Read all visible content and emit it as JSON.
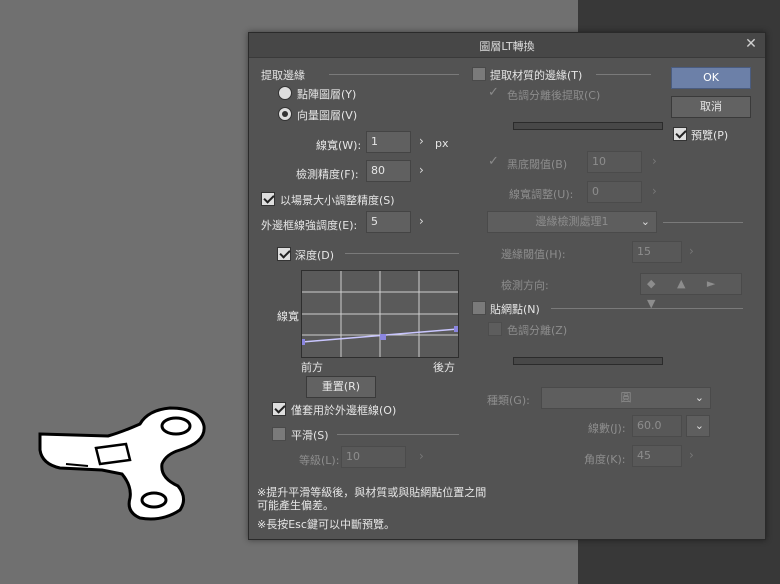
{
  "dialog": {
    "title": "圖層LT轉換",
    "close_icon": "close-icon",
    "extract_lines": {
      "header": "提取邊緣",
      "raster_layer": "點陣圖層(Y)",
      "vector_layer": "向量圖層(V)",
      "line_width_label": "線寬(W):",
      "line_width_value": "1",
      "line_width_unit": "px",
      "precision_label": "檢測精度(F):",
      "precision_value": "80",
      "scale_by_size": "以場景大小調整精度(S)",
      "outline_strength_label": "外邊框線強調度(E):",
      "outline_strength_value": "5",
      "depth_label": "深度(D)",
      "graph_ylabel": "線寬",
      "graph_front": "前方",
      "graph_back": "後方",
      "reset_button": "重置(R)",
      "apply_outline_only": "僅套用於外邊框線(O)",
      "smooth_label": "平滑(S)",
      "level_label": "等級(L):",
      "level_value": "10"
    },
    "texture": {
      "header": "提取材質的邊緣(T)",
      "extract_after_tone": "色調分離後提取(C)",
      "black_threshold_label": "黑底閾值(B)",
      "black_threshold_value": "10",
      "line_adjust_label": "線寬調整(U):",
      "line_adjust_value": "0",
      "edge_process": "邊緣檢測處理1",
      "edge_threshold_label": "邊緣閾值(H):",
      "edge_threshold_value": "15",
      "detect_direction_label": "檢測方向:",
      "direction_arrows": "◆ ▲ ► ▼"
    },
    "halftone": {
      "header": "貼網點(N)",
      "tone_separation": "色調分離(Z)",
      "type_label": "種類(G):",
      "type_value": "圓",
      "lines_label": "線數(J):",
      "lines_value": "60.0",
      "angle_label": "角度(K):",
      "angle_value": "45"
    },
    "buttons": {
      "ok": "OK",
      "cancel": "取消",
      "preview": "預覽(P)"
    },
    "notes": {
      "line1": "※提升平滑等級後，與材質或與貼網點位置之間",
      "line2": "可能產生偏差。",
      "line3": "※長按Esc鍵可以中斷預覽。"
    }
  }
}
